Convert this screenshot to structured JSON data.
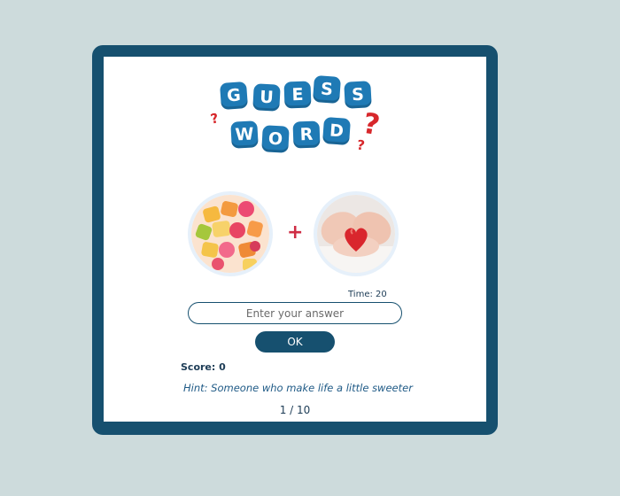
{
  "logo": {
    "row1": [
      "G",
      "U",
      "E",
      "S",
      "S"
    ],
    "row2": [
      "W",
      "O",
      "R",
      "D"
    ],
    "question_mark": "?"
  },
  "game": {
    "images": [
      {
        "name": "candies",
        "description": "colorful candies"
      },
      {
        "name": "heart-hands",
        "description": "hands holding red heart"
      }
    ],
    "plus_symbol": "+",
    "timer_label": "Time: 20",
    "answer_placeholder": "Enter your answer",
    "answer_value": "",
    "ok_label": "OK",
    "score_label": "Score: 0",
    "hint": "Hint: Someone who make life a little sweeter",
    "progress": "1 / 10"
  },
  "colors": {
    "background": "#cddbdc",
    "frame": "#16506f",
    "tile": "#1f7ab5",
    "question_mark": "#d7272b",
    "plus": "#cf2d45"
  }
}
